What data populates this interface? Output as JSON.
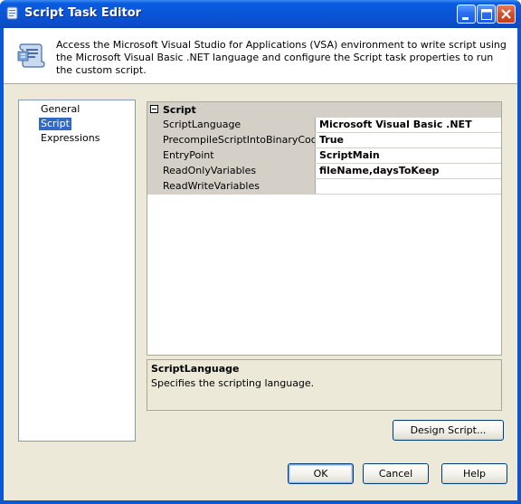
{
  "window": {
    "title": "Script Task Editor"
  },
  "header": {
    "description": "Access the Microsoft Visual Studio for Applications (VSA) environment to write script using the Microsoft Visual Basic .NET language and configure the Script task properties to run the custom script."
  },
  "nav": {
    "items": [
      {
        "label": "General",
        "selected": false
      },
      {
        "label": "Script",
        "selected": true
      },
      {
        "label": "Expressions",
        "selected": false
      }
    ]
  },
  "properties": {
    "category": "Script",
    "rows": [
      {
        "name": "ScriptLanguage",
        "value": "Microsoft Visual Basic .NET"
      },
      {
        "name": "PrecompileScriptIntoBinaryCode",
        "value": "True"
      },
      {
        "name": "EntryPoint",
        "value": "ScriptMain"
      },
      {
        "name": "ReadOnlyVariables",
        "value": "fileName,daysToKeep"
      },
      {
        "name": "ReadWriteVariables",
        "value": ""
      }
    ]
  },
  "description_panel": {
    "title": "ScriptLanguage",
    "text": "Specifies the scripting language."
  },
  "buttons": {
    "design_script": "Design Script...",
    "ok": "OK",
    "cancel": "Cancel",
    "help": "Help"
  },
  "colors": {
    "titlebar": "#0a5ce0",
    "selection": "#316ac5",
    "dialog_bg": "#ece9d8"
  },
  "icons": {
    "title": "script-task-icon",
    "header": "script-scroll-icon",
    "minimize": "minimize-icon",
    "maximize": "maximize-icon",
    "close": "close-icon",
    "collapse": "collapse-minus-icon"
  }
}
